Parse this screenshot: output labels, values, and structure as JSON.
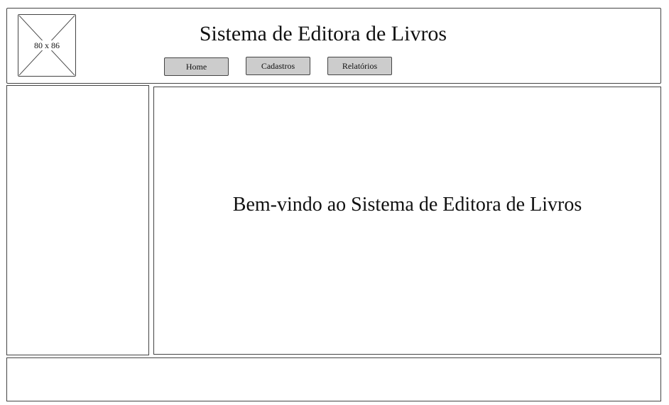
{
  "header": {
    "title": "Sistema de Editora de Livros",
    "logo_placeholder": "80 x 86"
  },
  "nav": {
    "items": [
      {
        "label": "Home"
      },
      {
        "label": "Cadastros"
      },
      {
        "label": "Relatórios"
      }
    ],
    "button_color": "#cccccc"
  },
  "main": {
    "welcome_text": "Bem-vindo ao Sistema de Editora de Livros"
  },
  "colors": {
    "border": "#444444",
    "background": "#ffffff"
  }
}
